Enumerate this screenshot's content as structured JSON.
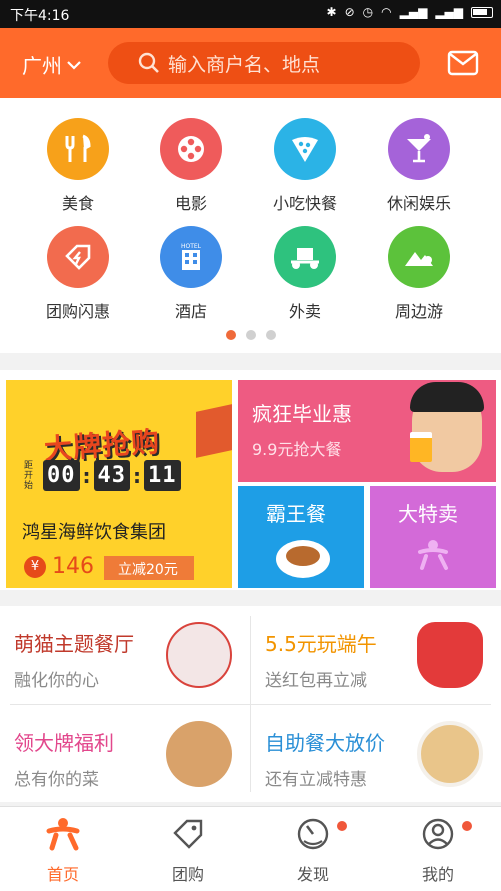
{
  "status_bar": {
    "time": "下午4:16"
  },
  "header": {
    "city": "广州",
    "search_placeholder": "输入商户名、地点"
  },
  "categories": [
    {
      "label": "美食",
      "icon": "fork-knife-icon",
      "color": "#f7a11a"
    },
    {
      "label": "电影",
      "icon": "film-reel-icon",
      "color": "#ef5b5b"
    },
    {
      "label": "小吃快餐",
      "icon": "pizza-slice-icon",
      "color": "#2bb3e6"
    },
    {
      "label": "休闲娱乐",
      "icon": "cocktail-icon",
      "color": "#a563d9"
    },
    {
      "label": "团购闪惠",
      "icon": "flash-tag-icon",
      "color": "#f26b4e"
    },
    {
      "label": "酒店",
      "icon": "hotel-icon",
      "color": "#3f8de8"
    },
    {
      "label": "外卖",
      "icon": "delivery-icon",
      "color": "#2ec27e"
    },
    {
      "label": "周边游",
      "icon": "mountain-icon",
      "color": "#5cc23b"
    }
  ],
  "pager": {
    "pages": 3,
    "active": 0
  },
  "promos": {
    "big": {
      "title": "大牌抢购",
      "countdown_side": "距开始",
      "countdown": [
        "00",
        "43",
        "11"
      ],
      "company": "鸿星海鲜饮食集团",
      "currency": "¥",
      "price": "146",
      "tag": "立减20元"
    },
    "graduation": {
      "title": "疯狂毕业惠",
      "subtitle": "9.9元抢大餐"
    },
    "bawang": {
      "title": "霸王餐"
    },
    "tezai": {
      "title": "大特卖"
    }
  },
  "themes": [
    {
      "title": "萌猫主题餐厅",
      "subtitle": "融化你的心",
      "title_color": "#c0392b"
    },
    {
      "title": "5.5元玩端午",
      "subtitle": "送红包再立减",
      "title_color": "#f29400"
    },
    {
      "title": "领大牌福利",
      "subtitle": "总有你的菜",
      "title_color": "#e2478c"
    },
    {
      "title": "自助餐大放价",
      "subtitle": "还有立减特惠",
      "title_color": "#2a8fd6"
    }
  ],
  "tabs": [
    {
      "label": "首页",
      "active": true
    },
    {
      "label": "团购",
      "active": false
    },
    {
      "label": "发现",
      "active": false,
      "badge": true
    },
    {
      "label": "我的",
      "active": false,
      "badge": true
    }
  ],
  "colors": {
    "brand": "#ff6a2b",
    "brand_dark": "#ee4f14"
  }
}
